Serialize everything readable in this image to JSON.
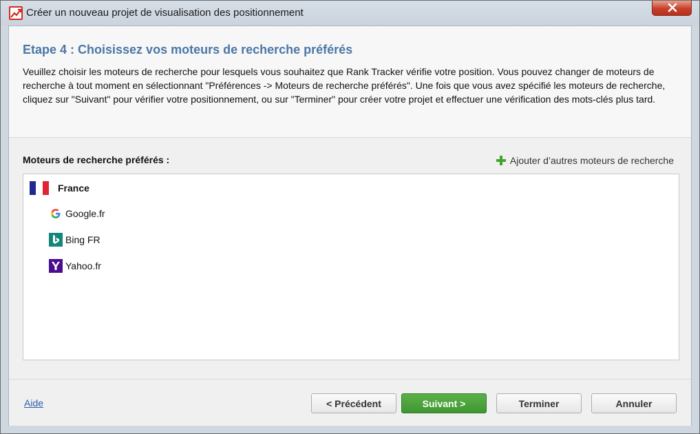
{
  "window": {
    "title": "Créer un nouveau projet de visualisation des positionnement"
  },
  "header": {
    "step_title": "Etape 4 : Choisissez vos moteurs de recherche préférés",
    "description": "Veuillez choisir les moteurs de recherche pour lesquels vous souhaitez que  Rank Tracker vérifie votre position. Vous pouvez changer de moteurs de recherche à tout moment en sélectionnant \"Préférences -> Moteurs de recherche préférés\". Une fois que vous avez spécifié les moteurs de recherche, cliquez sur \"Suivant\" pour vérifier votre positionnement, ou sur \"Terminer\" pour créer votre projet et effectuer une vérification des mots-clés plus tard."
  },
  "engines_panel": {
    "label": "Moteurs de recherche préférés :",
    "add_link": "Ajouter d’autres moteurs de recherche",
    "country": "France",
    "engines": [
      {
        "label": "Google.fr",
        "icon": "google-icon"
      },
      {
        "label": "Bing FR",
        "icon": "bing-icon"
      },
      {
        "label": "Yahoo.fr",
        "icon": "yahoo-icon"
      }
    ]
  },
  "footer": {
    "help": "Aide",
    "prev": "< Précédent",
    "next": "Suivant >",
    "finish": "Terminer",
    "cancel": "Annuler"
  },
  "colors": {
    "title_blue": "#4a77a6",
    "next_green": "#4aa33a",
    "plus_green": "#43a32f"
  }
}
